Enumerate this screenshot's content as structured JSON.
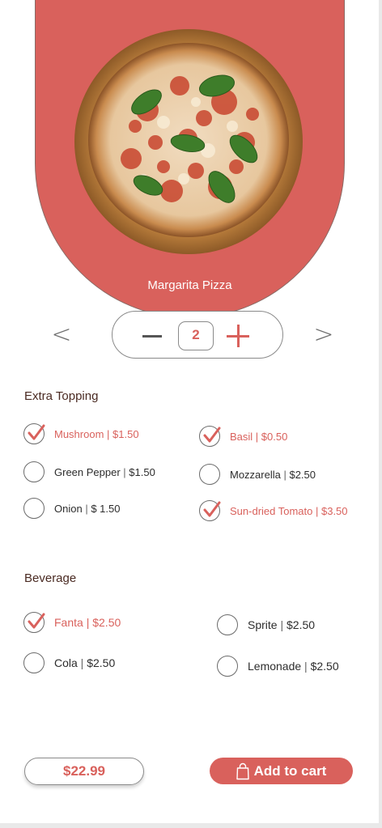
{
  "product": {
    "name": "Margarita Pizza",
    "quantity": "2"
  },
  "icons": {
    "prev": "chevron-left-icon",
    "next": "chevron-right-icon",
    "minus": "minus-icon",
    "plus": "plus-icon",
    "check": "checkmark-icon",
    "bag": "shopping-bag-icon"
  },
  "navigation": {
    "prev_glyph": "<",
    "next_glyph": ">"
  },
  "extra_topping": {
    "title": "Extra Topping",
    "items": [
      {
        "name": "Mushroom",
        "sep": " | ",
        "price": "$1.50",
        "checked": true
      },
      {
        "name": "Basil",
        "sep": " | ",
        "price": "$0.50",
        "checked": true
      },
      {
        "name": "Green Pepper",
        "sep": " | ",
        "price": "$1.50",
        "checked": false
      },
      {
        "name": "Mozzarella",
        "sep": " | ",
        "price": "$2.50",
        "checked": false
      },
      {
        "name": "Onion",
        "sep": " | ",
        "price": "$ 1.50",
        "checked": false
      },
      {
        "name": "Sun-dried Tomato",
        "sep": " | ",
        "price": "$3.50",
        "checked": true
      }
    ]
  },
  "beverage": {
    "title": "Beverage",
    "items": [
      {
        "name": "Fanta",
        "sep": " | ",
        "price": "$2.50",
        "checked": true
      },
      {
        "name": "Sprite",
        "sep": " | ",
        "price": "$2.50",
        "checked": false
      },
      {
        "name": "Cola",
        "sep": " | ",
        "price": "$2.50",
        "checked": false
      },
      {
        "name": "Lemonade",
        "sep": " | ",
        "price": "$2.50",
        "checked": false
      }
    ]
  },
  "footer": {
    "total": "$22.99",
    "add_to_cart": "Add to cart"
  },
  "colors": {
    "accent": "#d9615c",
    "text_dark": "#4a2a22"
  }
}
